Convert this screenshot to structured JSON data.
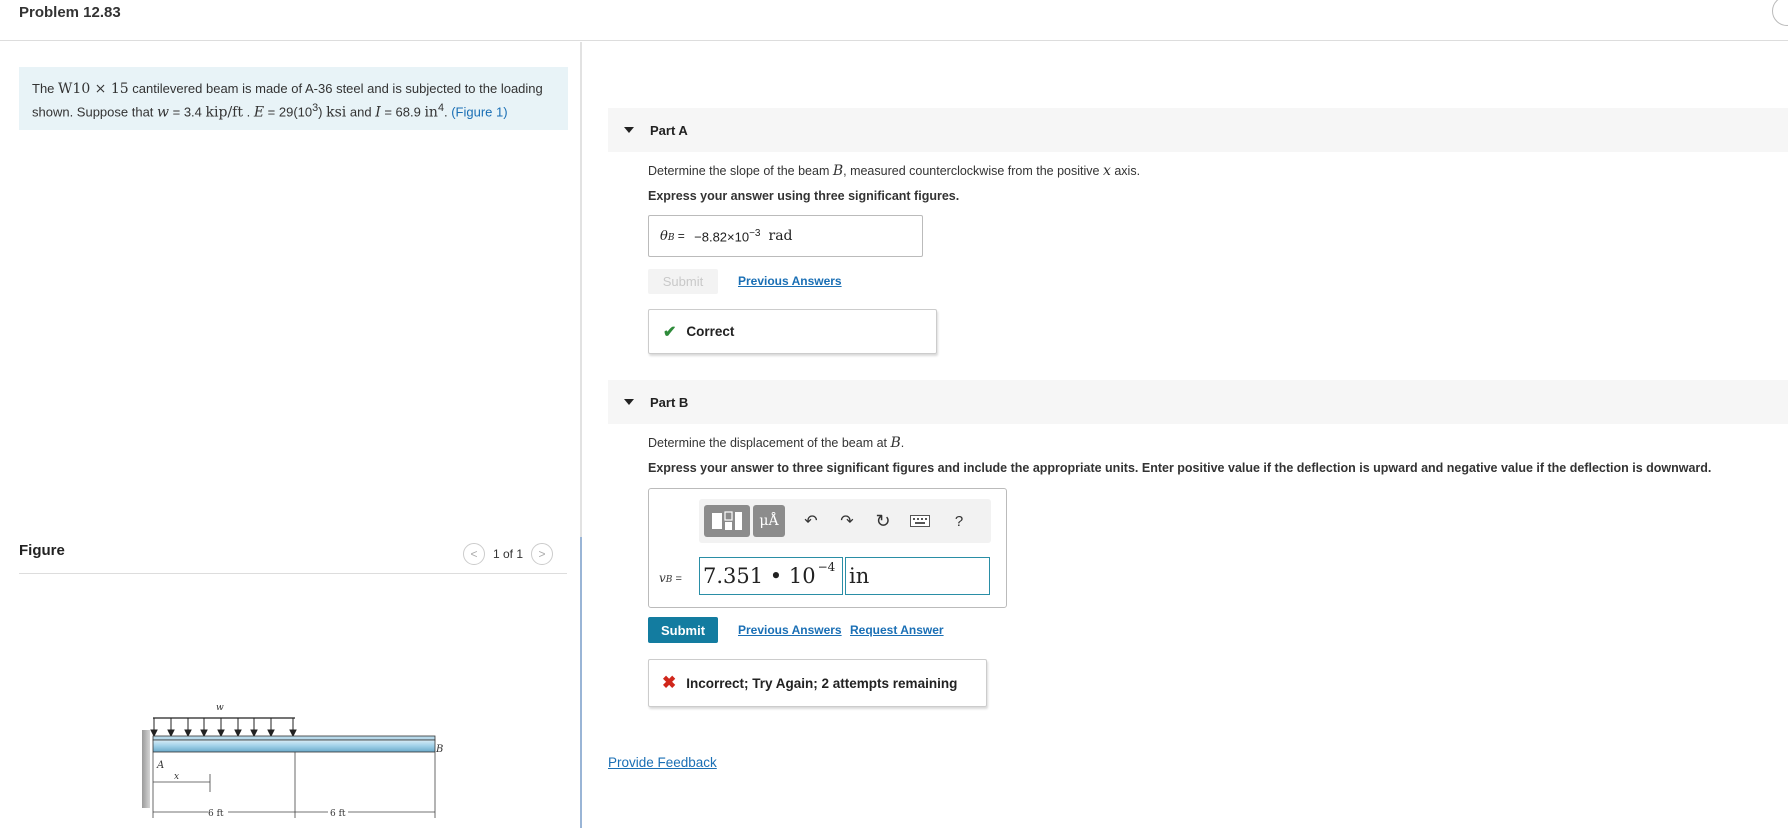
{
  "header": {
    "title": "Problem 12.83"
  },
  "statement": {
    "p1": "The ",
    "beam": "W10 × 15",
    "p2": " cantilevered beam is made of A-36 steel and is subjected to the loading shown. Suppose that ",
    "w_sym": "w",
    "w_val": " = 3.4 ",
    "w_unit": "kip/ft",
    "sep": " . ",
    "E_sym": "E",
    "E_val": " = 29(10",
    "E_exp": "3",
    "E_close": ") ",
    "E_unit": "ksi",
    "and": " and ",
    "I_sym": "I",
    "I_val": " = 68.9 ",
    "I_unit": "in",
    "I_exp": "4",
    "end": ". ",
    "figure_link": "(Figure 1)"
  },
  "figure": {
    "label": "Figure",
    "pager": "1 of 1",
    "prev_icon": "chevron-left-icon",
    "next_icon": "chevron-right-icon",
    "labels": {
      "w": "w",
      "a": "A",
      "b": "B",
      "x": "x",
      "d1": "6 ft",
      "d2": "6 ft"
    }
  },
  "partA": {
    "label": "Part A",
    "question_pre": "Determine the slope of the beam ",
    "question_B": "B",
    "question_mid": ", measured counterclockwise from the positive ",
    "question_x": "x",
    "question_post": " axis.",
    "instruction": "Express your answer using three significant figures.",
    "answer": {
      "lhs": "θ",
      "lhs_sub": "B",
      "eq": " = ",
      "value": "−8.82×10",
      "exp": "−3",
      "unit": "rad"
    },
    "submit_label": "Submit",
    "previous_answers": "Previous Answers",
    "feedback": "Correct"
  },
  "partB": {
    "label": "Part B",
    "question_pre": "Determine the displacement of the beam at ",
    "question_B": "B",
    "question_post": ".",
    "instruction": "Express your answer to three significant figures and include the appropriate units. Enter positive value if the deflection is upward and negative value if the deflection is downward.",
    "toolbar": {
      "units_label": "μÅ",
      "help": "?"
    },
    "answer": {
      "lhs": "v",
      "lhs_sub": "B",
      "eq": " = ",
      "value": "7.351 • 10",
      "exp": "−4",
      "unit": "in"
    },
    "submit_label": "Submit",
    "previous_answers": "Previous Answers",
    "request_answer": "Request Answer",
    "feedback": "Incorrect; Try Again; 2 attempts remaining"
  },
  "footer": {
    "provide_feedback": "Provide Feedback"
  },
  "colors": {
    "accent": "#137ca0",
    "link": "#1a6fb5",
    "correct": "#2e8b3a",
    "incorrect": "#d0261b",
    "statement_bg": "#e8f3f7"
  }
}
